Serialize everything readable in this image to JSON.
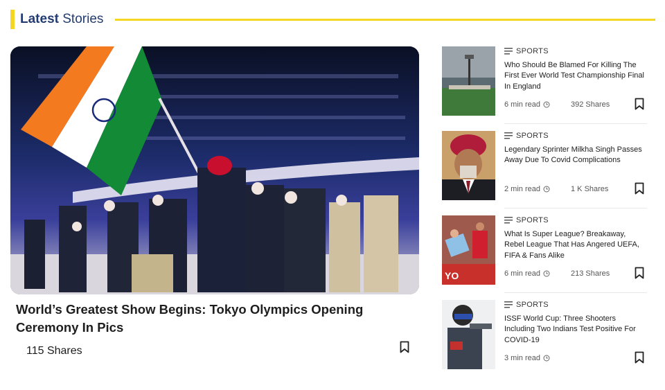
{
  "section": {
    "title_bold": "Latest",
    "title_rest": "Stories"
  },
  "featured": {
    "headline": "World’s Greatest Show Begins: Tokyo Olympics Opening Ceremony In Pics",
    "shares": "115 Shares"
  },
  "stories": [
    {
      "category": "SPORTS",
      "title": "Who Should Be Blamed For Killing The First Ever World Test Championship Final In England",
      "read_time": "6 min read",
      "shares": "392 Shares"
    },
    {
      "category": "SPORTS",
      "title": "Legendary Sprinter Milkha Singh Passes Away Due To Covid Complications",
      "read_time": "2 min read",
      "shares": "1 K Shares"
    },
    {
      "category": "SPORTS",
      "title": "What Is Super League? Breakaway, Rebel League That Has Angered UEFA, FIFA & Fans Alike",
      "read_time": "6 min read",
      "shares": "213 Shares"
    },
    {
      "category": "SPORTS",
      "title": "ISSF World Cup: Three Shooters Including Two Indians Test Positive For COVID-19",
      "read_time": "3 min read",
      "shares": ""
    }
  ],
  "colors": {
    "accent_yellow": "#f5d623",
    "title_navy": "#233b73"
  }
}
